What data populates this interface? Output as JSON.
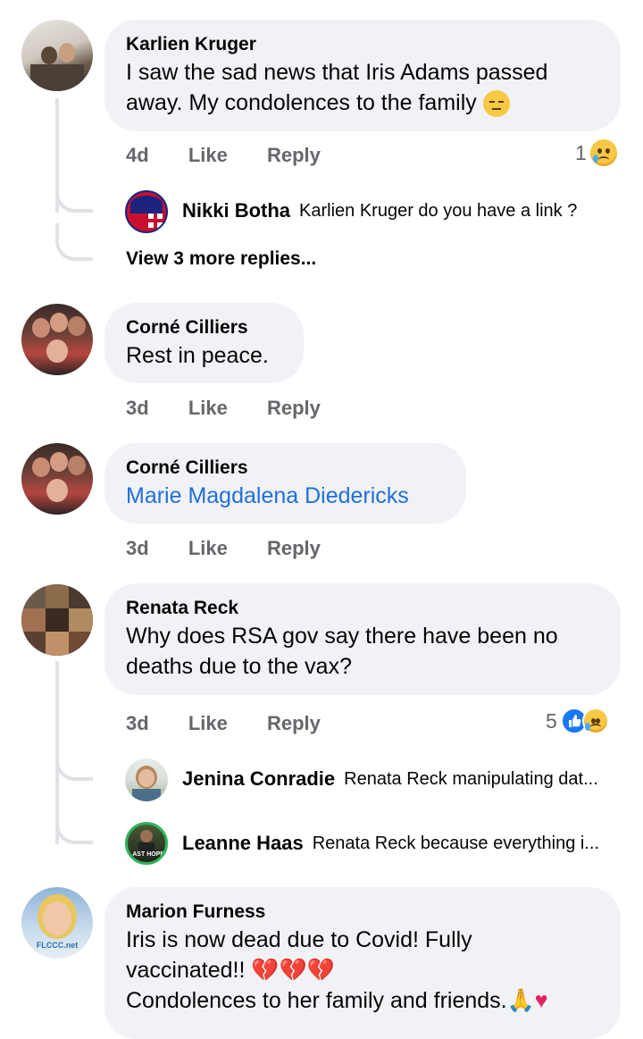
{
  "comments": [
    {
      "author": "Karlien Kruger",
      "text1": "I saw the sad news that Iris Adams passed",
      "text2": "away.  My condolences to the family",
      "time": "4d",
      "like": "Like",
      "reply": "Reply",
      "reaction_count": "1",
      "replies": [
        {
          "author": "Nikki Botha",
          "text": "Karlien Kruger do you have a link ?"
        }
      ],
      "view_more": "View 3 more replies..."
    },
    {
      "author": "Corné Cilliers",
      "text": "Rest in peace.",
      "time": "3d",
      "like": "Like",
      "reply": "Reply"
    },
    {
      "author": "Corné Cilliers",
      "text": "Marie Magdalena Diedericks",
      "time": "3d",
      "like": "Like",
      "reply": "Reply"
    },
    {
      "author": "Renata Reck",
      "text1": "Why does RSA gov say there have been no",
      "text2": "deaths due to the vax?",
      "time": "3d",
      "like": "Like",
      "reply": "Reply",
      "reaction_count": "5",
      "replies": [
        {
          "author": "Jenina Conradie",
          "text": "Renata Reck manipulating dat..."
        },
        {
          "author": "Leanne Haas",
          "text": "Renata Reck because everything i..."
        }
      ],
      "avatar_caption": "LAST HOPE"
    },
    {
      "author": "Marion Furness",
      "text1": "Iris is now dead due to Covid!  Fully",
      "text2": "vaccinated!! ",
      "text3": "Condolences to her family and friends.",
      "avatar_caption": "FLCCC.net"
    }
  ],
  "colors": {
    "bubble": "#f0f2f5",
    "link": "#216fdb",
    "meta": "#65676b",
    "like_blue": "#1877f2"
  }
}
